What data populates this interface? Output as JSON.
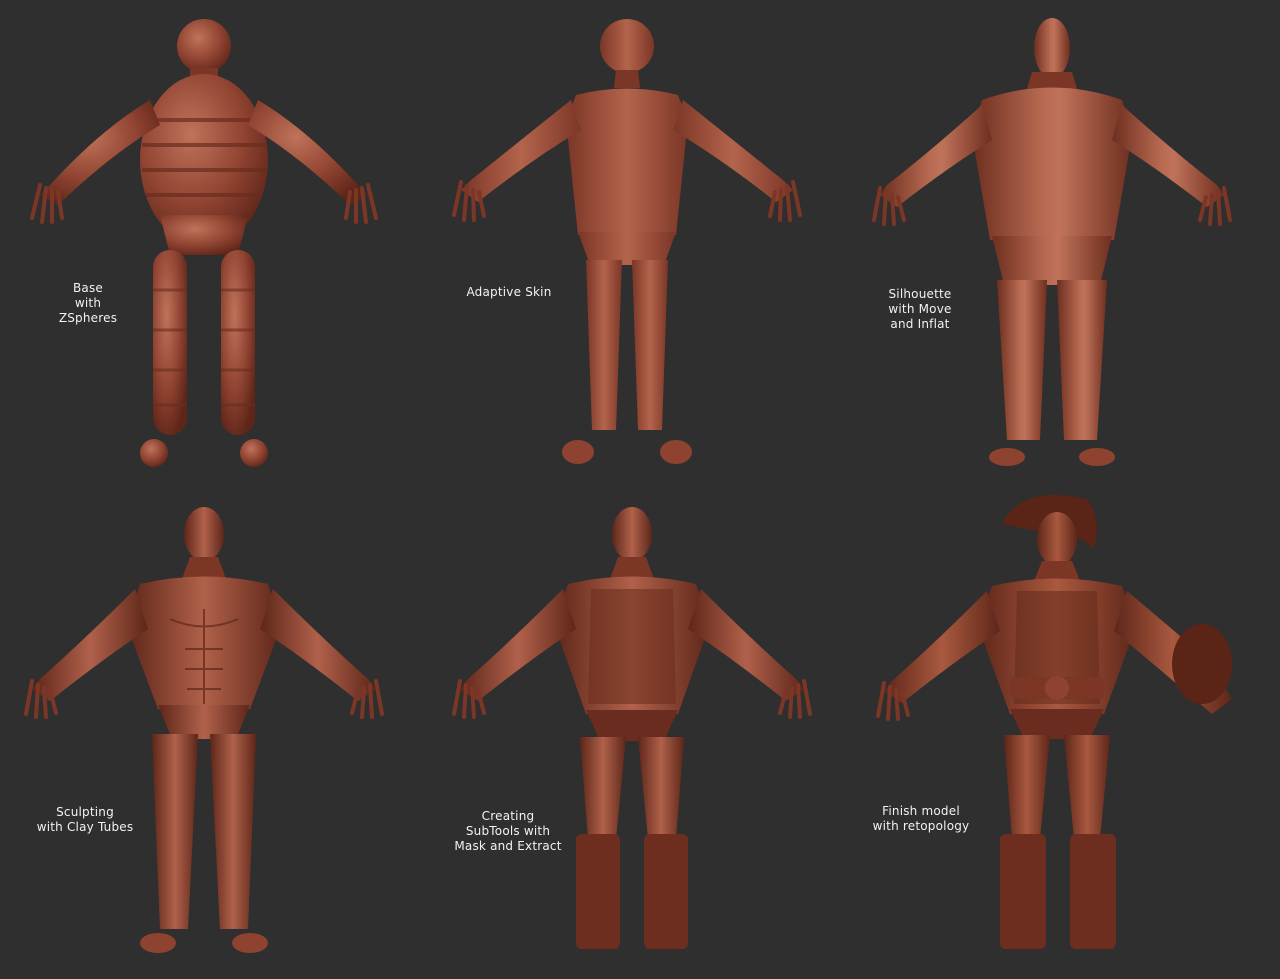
{
  "stages": [
    {
      "caption": "Base\nwith\nZSpheres",
      "figure": "zsphere-base-figure"
    },
    {
      "caption": "Adaptive Skin",
      "figure": "adaptive-skin-figure"
    },
    {
      "caption": "Silhouette\nwith Move\nand Inflat",
      "figure": "silhouette-figure"
    },
    {
      "caption": "Sculpting\nwith Clay Tubes",
      "figure": "clay-tubes-figure"
    },
    {
      "caption": "Creating\nSubTools with\nMask and Extract",
      "figure": "subtools-figure"
    },
    {
      "caption": "Finish model\nwith retopology",
      "figure": "finished-model-figure"
    }
  ],
  "colors": {
    "background": "#2f2f2f",
    "clay_dark": "#6e2e1f",
    "clay_mid": "#9a4a35",
    "clay_light": "#c0735a",
    "caption_text": "#f2f2f2"
  }
}
